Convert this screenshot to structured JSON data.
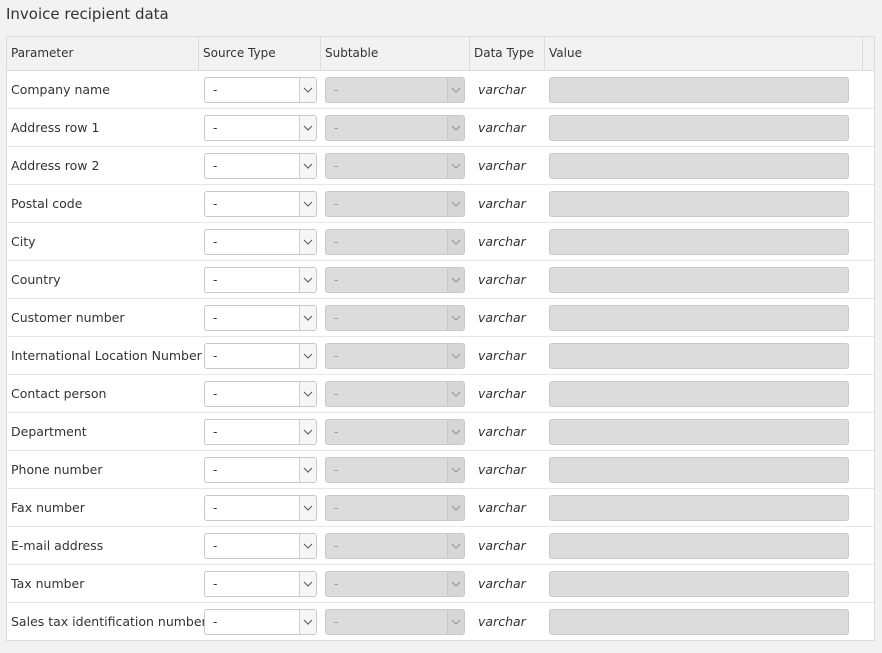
{
  "section": {
    "title": "Invoice recipient data"
  },
  "table": {
    "headers": {
      "parameter": "Parameter",
      "source_type": "Source Type",
      "subtable": "Subtable",
      "data_type": "Data Type",
      "value": "Value"
    },
    "rows": [
      {
        "parameter": "Company name",
        "source_type": "-",
        "subtable": "-",
        "data_type": "varchar"
      },
      {
        "parameter": "Address row 1",
        "source_type": "-",
        "subtable": "-",
        "data_type": "varchar"
      },
      {
        "parameter": "Address row 2",
        "source_type": "-",
        "subtable": "-",
        "data_type": "varchar"
      },
      {
        "parameter": "Postal code",
        "source_type": "-",
        "subtable": "-",
        "data_type": "varchar"
      },
      {
        "parameter": "City",
        "source_type": "-",
        "subtable": "-",
        "data_type": "varchar"
      },
      {
        "parameter": "Country",
        "source_type": "-",
        "subtable": "-",
        "data_type": "varchar"
      },
      {
        "parameter": "Customer number",
        "source_type": "-",
        "subtable": "-",
        "data_type": "varchar"
      },
      {
        "parameter": "International Location Number",
        "source_type": "-",
        "subtable": "-",
        "data_type": "varchar"
      },
      {
        "parameter": "Contact person",
        "source_type": "-",
        "subtable": "-",
        "data_type": "varchar"
      },
      {
        "parameter": "Department",
        "source_type": "-",
        "subtable": "-",
        "data_type": "varchar"
      },
      {
        "parameter": "Phone number",
        "source_type": "-",
        "subtable": "-",
        "data_type": "varchar"
      },
      {
        "parameter": "Fax number",
        "source_type": "-",
        "subtable": "-",
        "data_type": "varchar"
      },
      {
        "parameter": "E-mail address",
        "source_type": "-",
        "subtable": "-",
        "data_type": "varchar"
      },
      {
        "parameter": "Tax number",
        "source_type": "-",
        "subtable": "-",
        "data_type": "varchar"
      },
      {
        "parameter": "Sales tax identification number",
        "source_type": "-",
        "subtable": "-",
        "data_type": "varchar"
      }
    ]
  },
  "icons": {
    "dropdown": "chevron-down-icon"
  },
  "colors": {
    "background": "#f2f2f2",
    "disabled_fill": "#dcdcdc",
    "border": "#c8c8c8"
  }
}
